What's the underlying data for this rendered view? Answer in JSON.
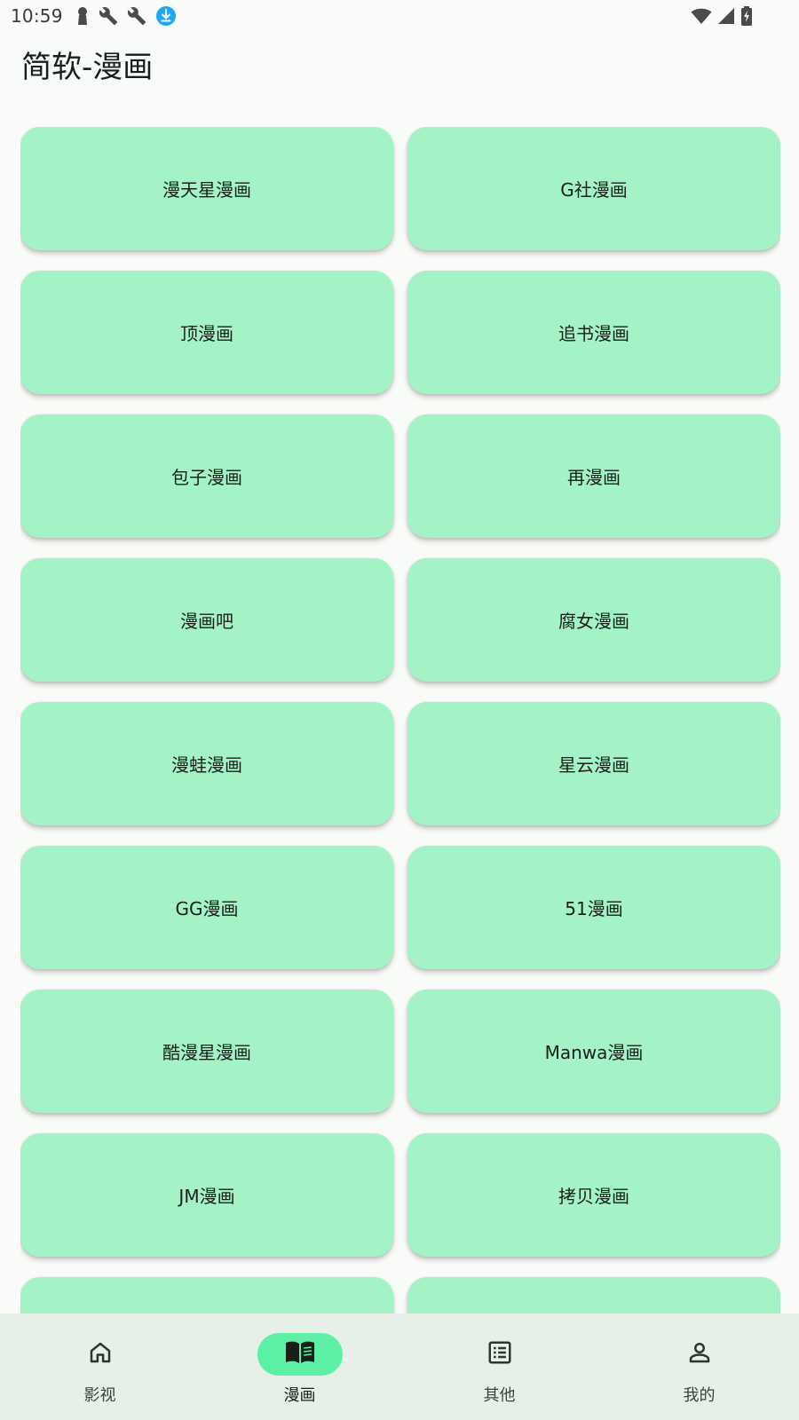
{
  "status_bar": {
    "time": "10:59",
    "left_icons": [
      "keyhole-icon",
      "wrench-icon",
      "wrench-icon",
      "download-icon"
    ],
    "right_icons": [
      "wifi-icon",
      "signal-icon",
      "battery-charging-icon"
    ],
    "download_color": "#1ea7f3"
  },
  "header": {
    "title": "简软-漫画"
  },
  "colors": {
    "card_bg": "#a3f3c6",
    "nav_bg": "#e6efe8",
    "nav_active_pill": "#5cefa6",
    "page_bg": "#f9fbf8"
  },
  "cards": [
    {
      "label": "漫天星漫画"
    },
    {
      "label": "G社漫画"
    },
    {
      "label": "顶漫画"
    },
    {
      "label": "追书漫画"
    },
    {
      "label": "包子漫画"
    },
    {
      "label": "再漫画"
    },
    {
      "label": "漫画吧"
    },
    {
      "label": "腐女漫画"
    },
    {
      "label": "漫蛙漫画"
    },
    {
      "label": "星云漫画"
    },
    {
      "label": "GG漫画"
    },
    {
      "label": "51漫画"
    },
    {
      "label": "酷漫星漫画"
    },
    {
      "label": "Manwa漫画"
    },
    {
      "label": "JM漫画"
    },
    {
      "label": "拷贝漫画"
    },
    {
      "label": ""
    },
    {
      "label": ""
    }
  ],
  "bottom_nav": {
    "items": [
      {
        "label": "影视",
        "icon": "home-icon",
        "active": false
      },
      {
        "label": "漫画",
        "icon": "book-icon",
        "active": true
      },
      {
        "label": "其他",
        "icon": "list-icon",
        "active": false
      },
      {
        "label": "我的",
        "icon": "person-icon",
        "active": false
      }
    ]
  }
}
